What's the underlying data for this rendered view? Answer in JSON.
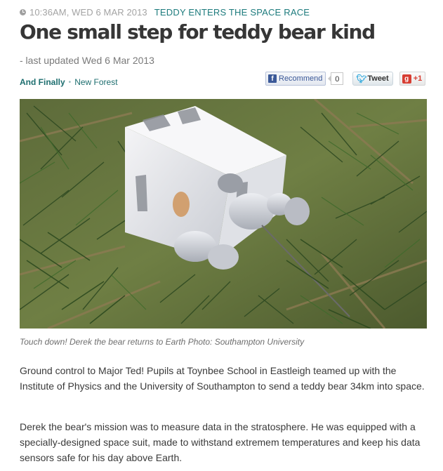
{
  "article": {
    "timestamp": "10:36AM, WED 6 MAR 2013",
    "category_label": "TEDDY ENTERS THE SPACE RACE",
    "headline": "One small step for teddy bear kind",
    "updated": "- last updated Wed 6 Mar 2013",
    "tags": [
      "And Finally",
      "New Forest"
    ],
    "image_caption": "Touch down! Derek the bear returns to Earth Photo: Southampton University",
    "paragraphs": [
      "Ground control to Major Ted! Pupils at Toynbee School in Eastleigh teamed up with the Institute of Physics and the University of Southampton to send a teddy bear 34km into space.",
      "Derek the bear's mission was to measure data in the stratosphere. He was equipped with a specially-designed space suit, made to withstand extremem temperatures and keep his data sensors safe for his day above Earth."
    ]
  },
  "social": {
    "facebook_label": "Recommend",
    "facebook_count": "0",
    "twitter_label": "Tweet",
    "google_label": "+1",
    "icons": {
      "facebook": "facebook-icon",
      "twitter": "twitter-bird-icon",
      "google": "google-plus-icon"
    }
  },
  "colors": {
    "accent": "#1d7b7d",
    "headline": "#363636",
    "meta": "#a3a3a3"
  }
}
